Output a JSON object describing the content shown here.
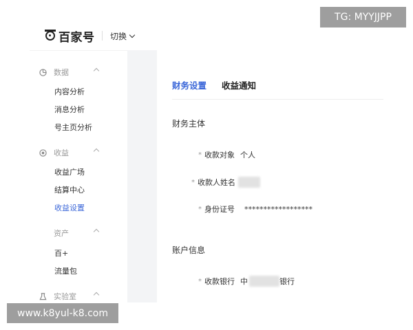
{
  "header": {
    "brand": "百家号",
    "switch_label": "切换"
  },
  "watermarks": {
    "tg": "TG: MYYJJPP",
    "url": "www.k8yul-k8.com"
  },
  "sidebar": {
    "groups": [
      {
        "label": "数据",
        "icon": "pie-chart-icon",
        "items": [
          "内容分析",
          "消息分析",
          "号主页分析"
        ]
      },
      {
        "label": "收益",
        "icon": "coin-icon",
        "items": [
          "收益广场",
          "结算中心",
          "收益设置"
        ]
      },
      {
        "label": "资产",
        "icon": "",
        "items": [
          "百+",
          "流量包"
        ]
      },
      {
        "label": "实验室",
        "icon": "flask-icon",
        "items": []
      }
    ],
    "active_item": "收益设置"
  },
  "main": {
    "tabs": [
      "财务设置",
      "收益通知"
    ],
    "active_tab": "财务设置",
    "sections": [
      {
        "title": "财务主体",
        "fields": [
          {
            "label": "收款对象",
            "value": "个人"
          },
          {
            "label": "收款人姓名",
            "value": ""
          },
          {
            "label": "身份证号",
            "value": "******************"
          }
        ]
      },
      {
        "title": "账户信息",
        "fields": [
          {
            "label": "收款银行",
            "value_prefix": "中",
            "value_suffix": "银行"
          }
        ]
      }
    ]
  },
  "colors": {
    "accent": "#3a66d8",
    "sidebar_bg": "#ffffff",
    "page_bg": "#f3f4f6"
  }
}
